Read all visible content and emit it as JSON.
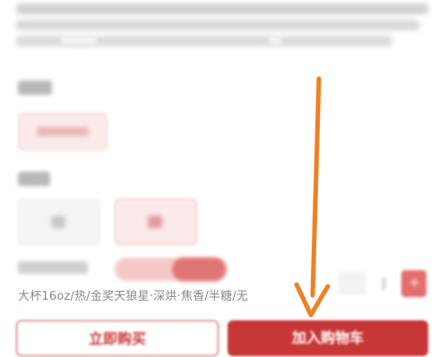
{
  "product": {
    "spec_summary": "大杯16oz/热/金奖天狼星·深烘·焦香/半糖/无"
  },
  "cup_section": {
    "label": "",
    "option": ""
  },
  "temp_section": {
    "label": "",
    "options": [
      "",
      ""
    ]
  },
  "quantity": {
    "minus_label": "",
    "value": "1",
    "plus_label": "+"
  },
  "actions": {
    "buy_now_label": "立即购买",
    "add_to_cart_label": "加入购物车"
  },
  "colors": {
    "accent": "#c83737",
    "annotation_arrow": "#f07f22"
  },
  "annotation": {
    "arrow_icon": "orange-down-arrow-icon"
  }
}
